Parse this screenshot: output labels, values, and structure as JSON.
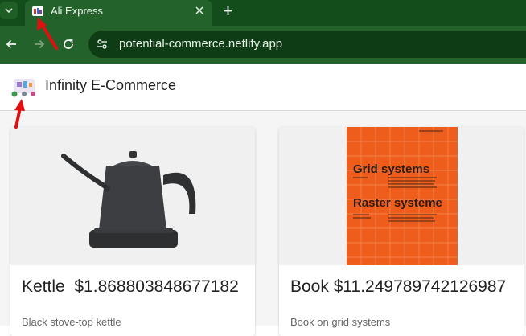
{
  "browser": {
    "tab": {
      "title": "Ali Express"
    },
    "url": "potential-commerce.netlify.app"
  },
  "site": {
    "title": "Infinity E-Commerce"
  },
  "products": [
    {
      "name": "Kettle",
      "price": "$1.868803848677182",
      "description": "Black stove-top kettle"
    },
    {
      "name": "Book",
      "price": "$11.249789742126987",
      "description": "Book on grid systems",
      "cover_line1": "Grid systems",
      "cover_line2": "Raster systeme"
    }
  ],
  "colors": {
    "chrome_dark": "#144d1c",
    "chrome": "#23632b",
    "omnibox": "#0e3d15",
    "book_orange": "#ee5d1c",
    "annotation_red": "#e01010"
  },
  "icons": [
    "tab-list-chevron-icon",
    "favicon-icon",
    "close-icon",
    "plus-icon",
    "back-arrow-icon",
    "forward-arrow-icon",
    "reload-icon",
    "site-info-icon",
    "logo-icon"
  ]
}
